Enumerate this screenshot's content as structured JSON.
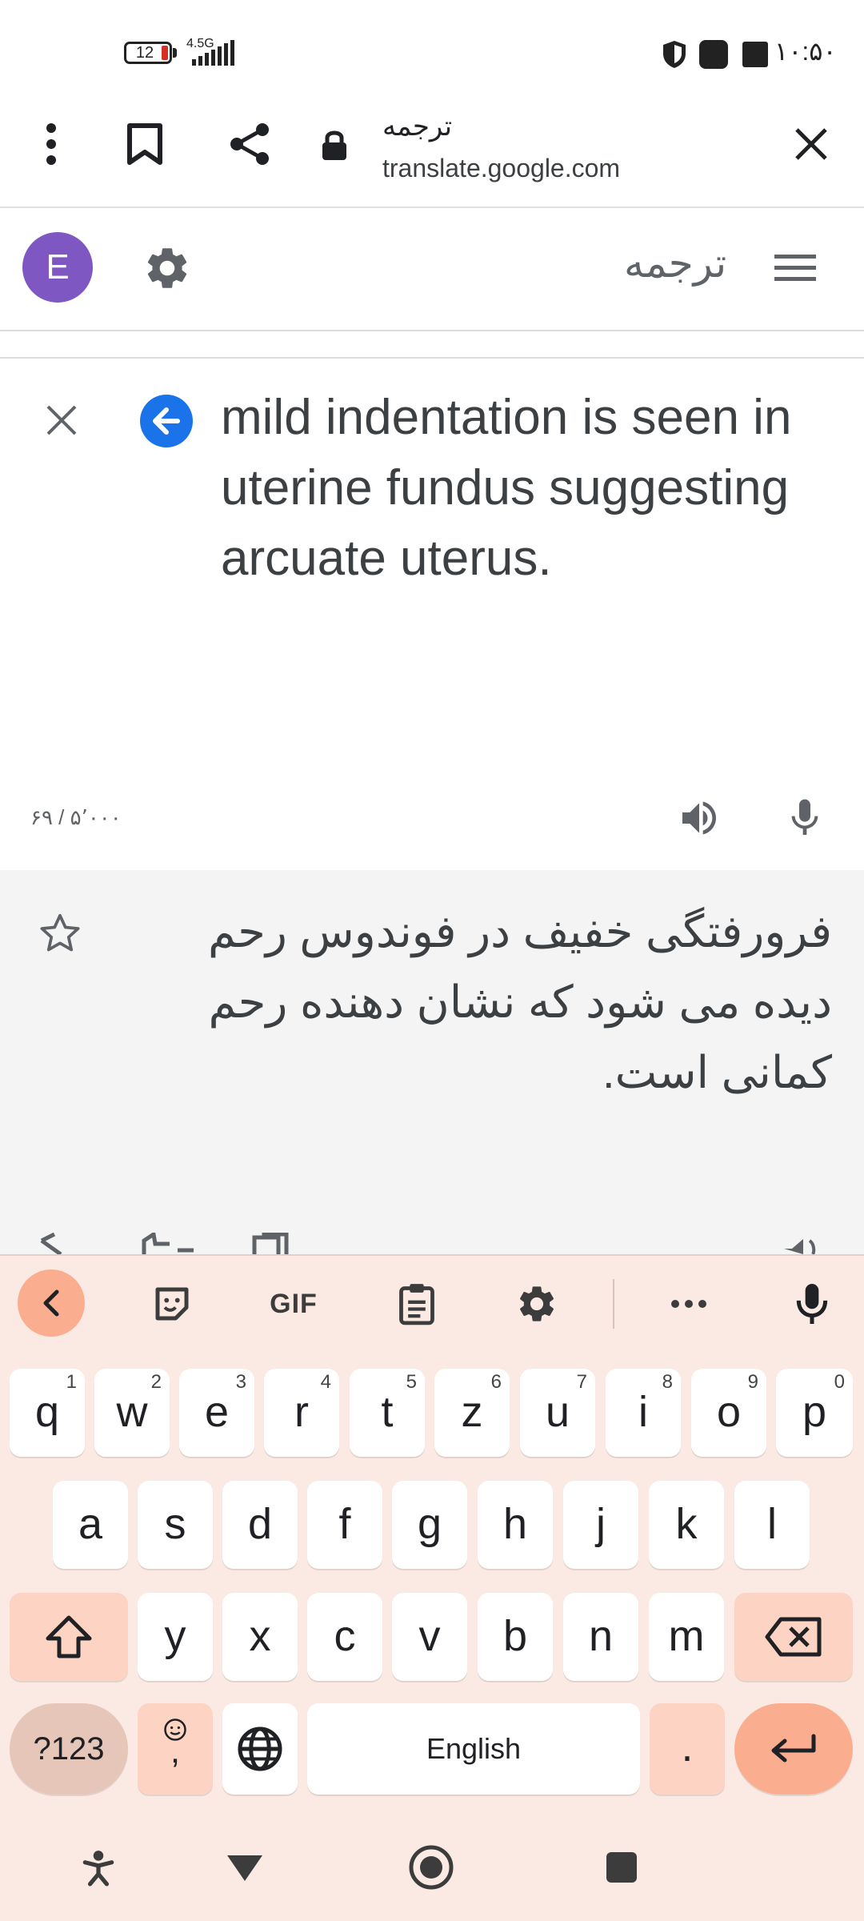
{
  "status_bar": {
    "time": "۱۰:۵۰",
    "battery": "12",
    "network": "4.5G"
  },
  "browser": {
    "page_title": "ترجمه",
    "url": "translate.google.com"
  },
  "app": {
    "avatar_letter": "E",
    "title": "ترجمه"
  },
  "input": {
    "source_text": "mild indentation is seen in uterine fundus suggesting arcuate uterus.",
    "char_count": "۶۹ / ۵٬۰۰۰"
  },
  "output": {
    "translation": "فرورفتگی خفیف در فوندوس رحم دیده می شود که نشان دهنده رحم کمانی است."
  },
  "keyboard": {
    "gif_label": "GIF",
    "row1": [
      {
        "k": "q",
        "h": "1"
      },
      {
        "k": "w",
        "h": "2"
      },
      {
        "k": "e",
        "h": "3"
      },
      {
        "k": "r",
        "h": "4"
      },
      {
        "k": "t",
        "h": "5"
      },
      {
        "k": "z",
        "h": "6"
      },
      {
        "k": "u",
        "h": "7"
      },
      {
        "k": "i",
        "h": "8"
      },
      {
        "k": "o",
        "h": "9"
      },
      {
        "k": "p",
        "h": "0"
      }
    ],
    "row2": [
      "a",
      "s",
      "d",
      "f",
      "g",
      "h",
      "j",
      "k",
      "l"
    ],
    "row3": [
      "y",
      "x",
      "c",
      "v",
      "b",
      "n",
      "m"
    ],
    "symbols_label": "?123",
    "emoji_comma_label": ",",
    "space_label": "English",
    "period_label": "."
  },
  "colors": {
    "avatar": "#7e57c2",
    "accent_blue": "#1a73e8",
    "keyboard_bg": "#fbeae4",
    "key_special": "#fdd4c3",
    "key_enter": "#fbae8f"
  }
}
